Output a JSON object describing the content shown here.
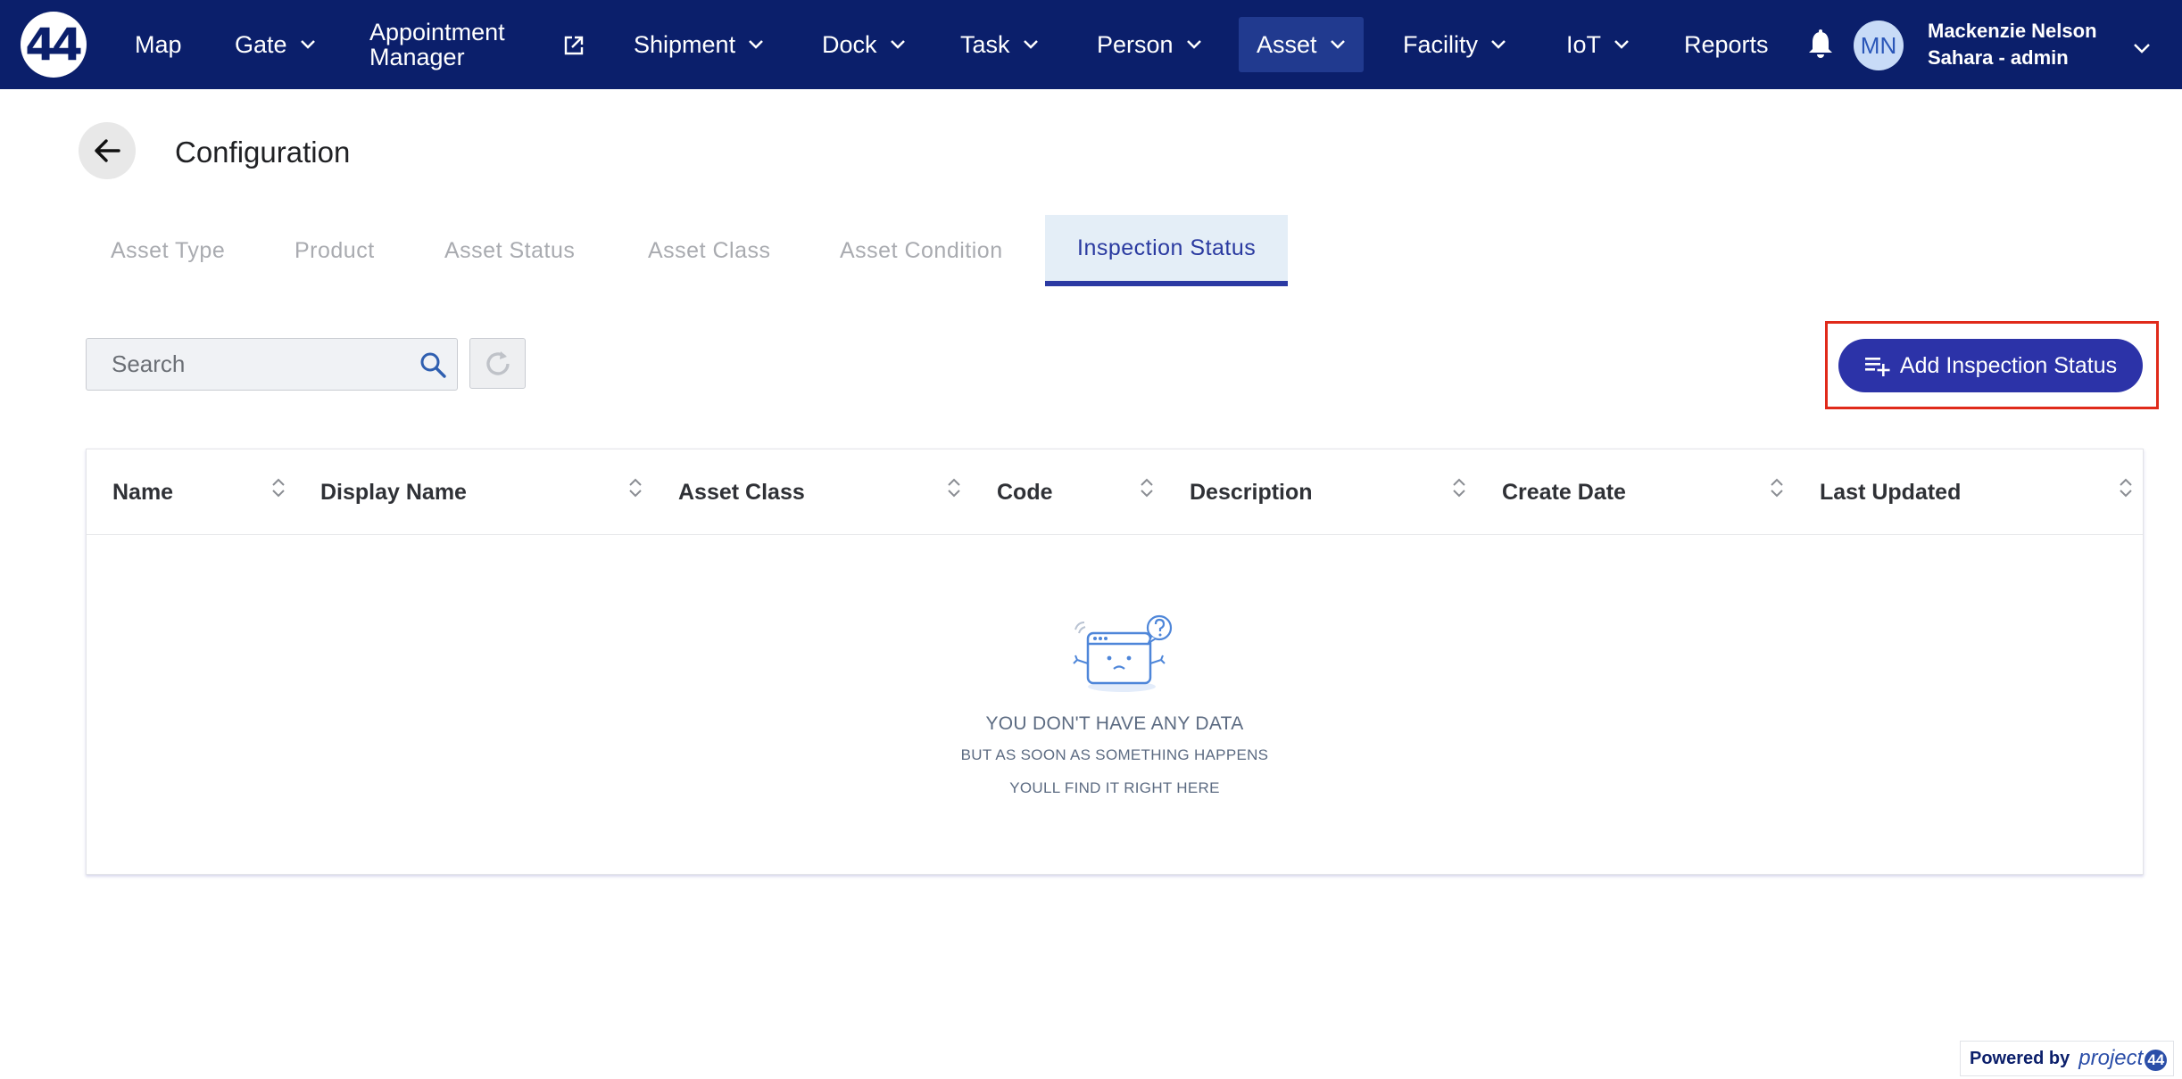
{
  "nav": {
    "logo": "44",
    "items": {
      "map": "Map",
      "gate": "Gate",
      "appointment_line1": "Appointment",
      "appointment_line2": "Manager",
      "shipment": "Shipment",
      "dock": "Dock",
      "task": "Task",
      "person": "Person",
      "asset": "Asset",
      "facility": "Facility",
      "iot": "IoT",
      "reports": "Reports"
    },
    "active_item": "Asset",
    "user": {
      "initials": "MN",
      "name": "Mackenzie Nelson",
      "role": "Sahara - admin"
    }
  },
  "header": {
    "title": "Configuration"
  },
  "tabs": [
    {
      "label": "Asset Type"
    },
    {
      "label": "Product"
    },
    {
      "label": "Asset Status"
    },
    {
      "label": "Asset Class"
    },
    {
      "label": "Asset Condition"
    },
    {
      "label": "Inspection Status",
      "active": true
    }
  ],
  "toolbar": {
    "search_placeholder": "Search",
    "add_label": "Add Inspection Status"
  },
  "table": {
    "columns": [
      "Name",
      "Display Name",
      "Asset Class",
      "Code",
      "Description",
      "Create Date",
      "Last Updated"
    ],
    "rows": [],
    "empty": {
      "title": "YOU DON'T HAVE ANY DATA",
      "line1": "BUT AS SOON AS SOMETHING HAPPENS",
      "line2": "YOULL FIND IT RIGHT HERE"
    }
  },
  "footer": {
    "powered_label": "Powered by",
    "brand": "project",
    "brand_mark": "44"
  },
  "colors": {
    "nav_bg": "#0b1f6b",
    "accent": "#2c33a8",
    "highlight": "#e02a1a",
    "active_tab_bg": "#e4eef7"
  },
  "icons": [
    "external-link-icon",
    "bell-icon",
    "chevron-down-icon",
    "arrow-left-icon",
    "search-icon",
    "refresh-icon",
    "playlist-add-icon",
    "sort-icon",
    "empty-state-illustration"
  ]
}
